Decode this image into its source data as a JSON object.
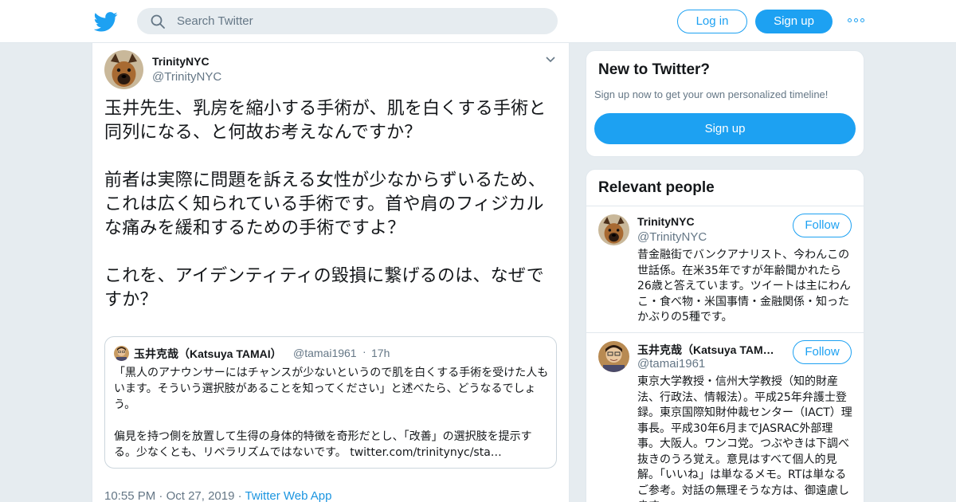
{
  "header": {
    "search_placeholder": "Search Twitter",
    "login_label": "Log in",
    "signup_label": "Sign up",
    "more_icon": "more-dots-icon",
    "logo_icon": "twitter-bird-icon",
    "accent_color": "#1da1f2"
  },
  "tweet": {
    "name": "TrinityNYC",
    "handle": "@TrinityNYC",
    "text": "玉井先生、乳房を縮小する手術が、肌を白くする手術と同列になる、と何故お考えなんですか？\n\n前者は実際に問題を訴える女性が少なからずいるため、これは広く知られている手術です。首や肩のフィジカルな痛みを緩和するための手術ですよ？\n\nこれを、アイデンティティの毀損に繋げるのは、なぜですか？",
    "quote": {
      "name": "玉井克哉（Katsuya TAMAI）",
      "handle": "@tamai1961",
      "separator": "·",
      "time": "17h",
      "text": "「黒人のアナウンサーにはチャンスが少ないというので肌を白くする手術を受けた人もいます。そういう選択肢があることを知ってください」と述べたら、どうなるでしょう。\n\n偏見を持つ側を放置して生得の身体的特徴を奇形だとし、「改善」の選択肢を提示する。少なくとも、リベラリズムではないです。 ",
      "link": "twitter.com/trinitynyc/sta…"
    },
    "time": "10:55 PM",
    "date": "Oct 27, 2019",
    "source": "Twitter Web App",
    "dot": "·"
  },
  "sidebar": {
    "new_title": "New to Twitter?",
    "new_sub": "Sign up now to get your own personalized timeline!",
    "signup_label": "Sign up",
    "relevant_title": "Relevant people",
    "people": [
      {
        "name": "TrinityNYC",
        "handle": "@TrinityNYC",
        "follow_label": "Follow",
        "bio": "昔金融街でバンクアナリスト、今わんこの世話係。在米35年ですが年齢聞かれたら26歳と答えています。ツイートは主にわんこ・食べ物・米国事情・金融関係・知ったかぶりの5種です。"
      },
      {
        "name": "玉井克哉（Katsuya TAMAI）",
        "handle": "@tamai1961",
        "follow_label": "Follow",
        "bio": "東京大学教授・信州大学教授（知的財産法、行政法、情報法）。平成25年弁護士登録。東京国際知財仲裁センター（IACT）理事長。平成30年6月までJASRAC外部理事。大阪人。ワンコ党。つぶやきは下調べ抜きのうろ覚え。意見はすべて個人的見解。「いいね」は単なるメモ。RTは単なるご参考。対話の無理そうな方は、御遠慮します。"
      }
    ]
  }
}
